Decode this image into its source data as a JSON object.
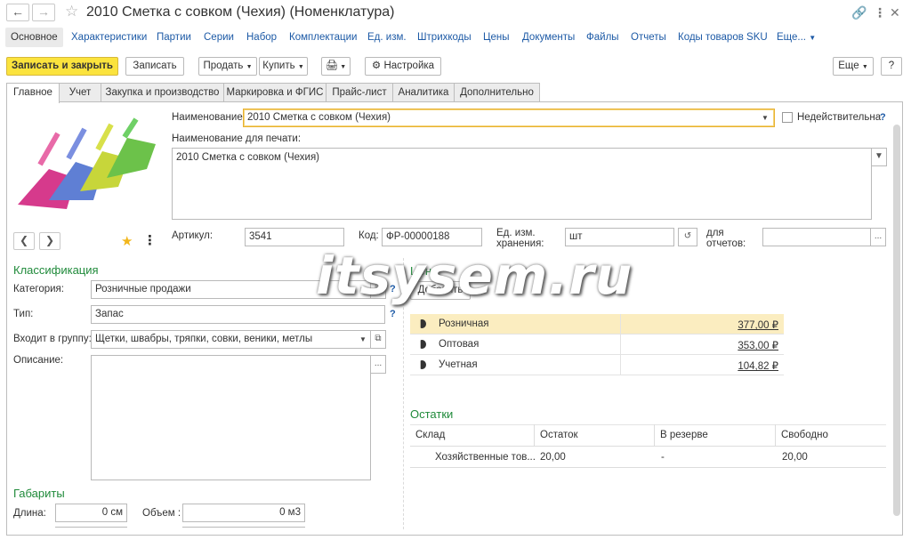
{
  "window": {
    "title": "2010 Сметка с совком (Чехия) (Номенклатура)",
    "back_icon": "arrow-left-icon",
    "forward_icon": "arrow-right-icon",
    "favorite_icon": "star-outline-icon",
    "link_icon": "link-icon",
    "more_icon": "more-vertical-icon",
    "maximize_icon": "maximize-icon",
    "close_icon": "close-icon"
  },
  "panel_nav": {
    "items": [
      "Основное",
      "Характеристики",
      "Партии",
      "Серии",
      "Набор",
      "Комплектации",
      "Ед. изм.",
      "Штрихкоды",
      "Цены",
      "Документы",
      "Файлы",
      "Отчеты",
      "Коды товаров SKU",
      "Еще..."
    ]
  },
  "toolbar": {
    "save_close": "Записать и закрыть",
    "save": "Записать",
    "sell": "Продать",
    "buy": "Купить",
    "settings": "Настройка",
    "more": "Еще",
    "help": "?"
  },
  "tabs": [
    "Главное",
    "Учет",
    "Закупка и производство",
    "Маркировка и ФГИС",
    "Прайс-лист",
    "Аналитика",
    "Дополнительно"
  ],
  "form": {
    "name_label": "Наименование:",
    "name_value": "2010 Сметка с совком (Чехия)",
    "inactive_label": "Недействительна",
    "print_name_label": "Наименование для печати:",
    "print_name_value": "2010 Сметка с совком (Чехия)",
    "article_label": "Артикул:",
    "article_value": "3541",
    "code_label": "Код:",
    "code_value": "ФР-00000188",
    "unit_label_1": "Ед. изм.",
    "unit_label_2": "хранения:",
    "unit_value": "шт",
    "reports_label_1": "для",
    "reports_label_2": "отчетов:",
    "reports_value": ""
  },
  "classification": {
    "title": "Классификация",
    "category_label": "Категория:",
    "category_value": "Розничные продажи",
    "type_label": "Тип:",
    "type_value": "Запас",
    "group_label": "Входит в группу:",
    "group_value": "Щетки, швабры, тряпки, совки, веники, метлы",
    "description_label": "Описание:"
  },
  "dimensions": {
    "title": "Габариты",
    "length_label": "Длина:",
    "length_value": "0 см",
    "volume_label": "Объем :",
    "volume_value": "0 м3"
  },
  "prices": {
    "title": "Цены",
    "add_button": "Добавить",
    "rows": [
      {
        "name": "Розничная",
        "value": "377,00 ₽"
      },
      {
        "name": "Оптовая",
        "value": "353,00 ₽"
      },
      {
        "name": "Учетная",
        "value": "104,82 ₽"
      }
    ]
  },
  "stock": {
    "title": "Остатки",
    "columns": [
      "Склад",
      "Остаток",
      "В резерве",
      "Свободно"
    ],
    "row": [
      "Хозяйственные тов...",
      "20,00",
      "-",
      "20,00"
    ]
  },
  "watermark": "itsysem.ru",
  "colors": {
    "accent_yellow": "#fbe33d",
    "link_blue": "#1d5aa6",
    "section_green": "#1f8a3a",
    "selected_row": "#fbedc0"
  }
}
